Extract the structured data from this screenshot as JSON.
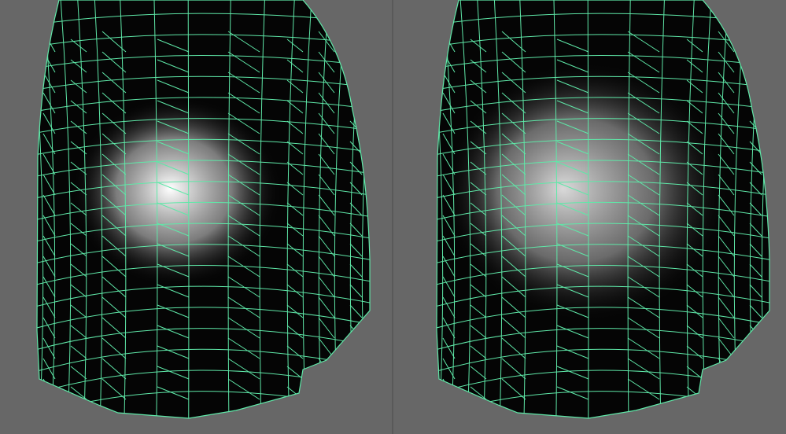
{
  "colors": {
    "background": "#676767",
    "divider": "#595959",
    "mesh_fill": "#050505",
    "wireframe": "#5fe8a8",
    "highlight": "#ffffff"
  },
  "panels": [
    {
      "id": "left",
      "weight_peak": 1.0,
      "weight_spread": 0.55
    },
    {
      "id": "right",
      "weight_peak": 0.85,
      "weight_spread": 0.75
    }
  ]
}
